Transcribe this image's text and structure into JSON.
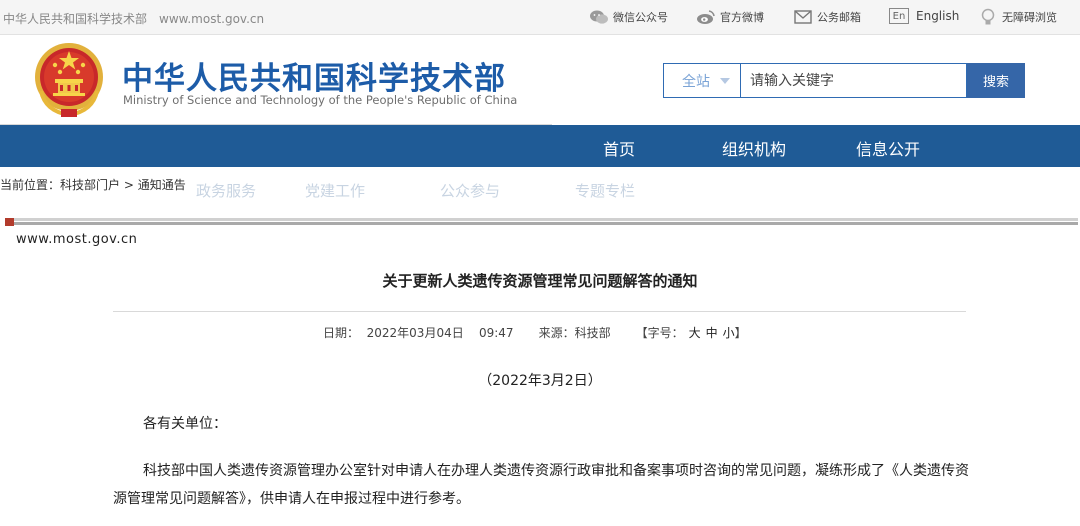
{
  "topbar": {
    "left_title": "中华人民共和国科学技术部",
    "left_url": "www.most.gov.cn",
    "links": {
      "wechat": "微信公众号",
      "weibo": "官方微博",
      "mail": "公务邮箱",
      "english_badge": "En",
      "english": "English",
      "accessibility": "无障碍浏览"
    }
  },
  "header": {
    "title": "中华人民共和国科学技术部",
    "subtitle": "Ministry of Science and Technology of the People's Republic of China",
    "search": {
      "scope": "全站",
      "placeholder": "请输入关键字",
      "button": "搜索"
    }
  },
  "nav": {
    "items": [
      "首页",
      "组织机构",
      "信息公开"
    ]
  },
  "breadcrumb": {
    "prefix": "当前位置：",
    "path": "科技部门户 > 通知通告"
  },
  "faded_nav": [
    "政务服务",
    "党建工作",
    "公众参与",
    "专题专栏"
  ],
  "article": {
    "watermark": "www.most.gov.cn",
    "title": "关于更新人类遗传资源管理常见问题解答的通知",
    "meta": {
      "date": "日期：  2022年03月04日    09:47",
      "source": "来源：科技部",
      "font_size_label": "【字号：",
      "font_large": "大",
      "font_medium": "中",
      "font_small": "小",
      "font_close": "】"
    },
    "date_line": "（2022年3月2日）",
    "salutation": "各有关单位：",
    "body": "科技部中国人类遗传资源管理办公室针对申请人在办理人类遗传资源行政审批和备案事项时咨询的常见问题，凝练形成了《人类遗传资源管理常见问题解答》，供申请人在申报过程中进行参考。"
  },
  "colors": {
    "brand_blue": "#1d5ca8",
    "nav_blue": "#1f5b96",
    "button_blue": "#3566a8",
    "accent_red": "#b23b2c"
  }
}
